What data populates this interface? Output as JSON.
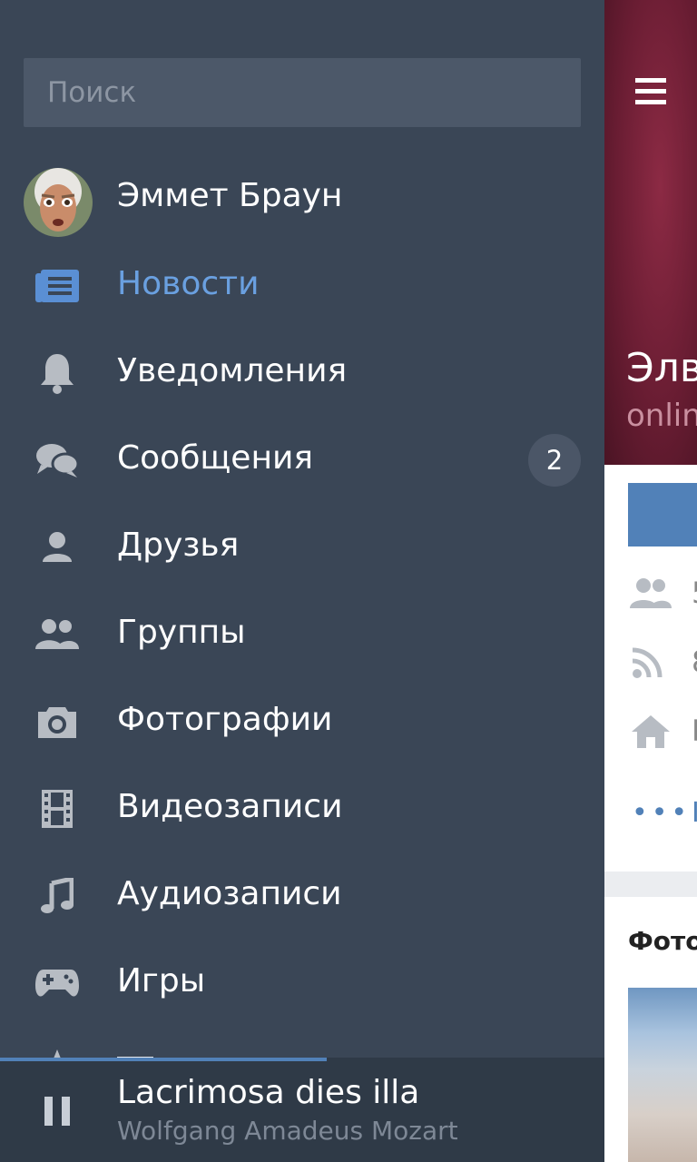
{
  "colors": {
    "drawer_bg": "#3a4656",
    "accent": "#5181b8",
    "active_text": "#6aa0e0",
    "cover": "#6a1d33"
  },
  "search": {
    "placeholder": "Поиск"
  },
  "profile": {
    "name": "Эммет Браун"
  },
  "menu": [
    {
      "label": "Новости",
      "icon": "newspaper-icon",
      "active": true
    },
    {
      "label": "Уведомления",
      "icon": "bell-icon"
    },
    {
      "label": "Сообщения",
      "icon": "chat-icon",
      "badge": "2"
    },
    {
      "label": "Друзья",
      "icon": "person-icon"
    },
    {
      "label": "Группы",
      "icon": "people-icon"
    },
    {
      "label": "Фотографии",
      "icon": "camera-icon"
    },
    {
      "label": "Видеозаписи",
      "icon": "film-icon"
    },
    {
      "label": "Аудиозаписи",
      "icon": "music-note-icon"
    },
    {
      "label": "Игры",
      "icon": "gamepad-icon"
    }
  ],
  "player": {
    "title": "Lacrimosa dies illa",
    "artist": "Wolfgang Amadeus Mozart",
    "progress": 0.54,
    "state_icon": "pause-icon"
  },
  "background_page": {
    "cover_name": "Элв",
    "cover_status": "onlin",
    "info_rows": [
      {
        "icon": "people-icon",
        "text": "5"
      },
      {
        "icon": "rss-icon",
        "text": "8"
      },
      {
        "icon": "home-icon",
        "text": "Г"
      }
    ],
    "more_text": "I",
    "photos_label": "Фото"
  }
}
